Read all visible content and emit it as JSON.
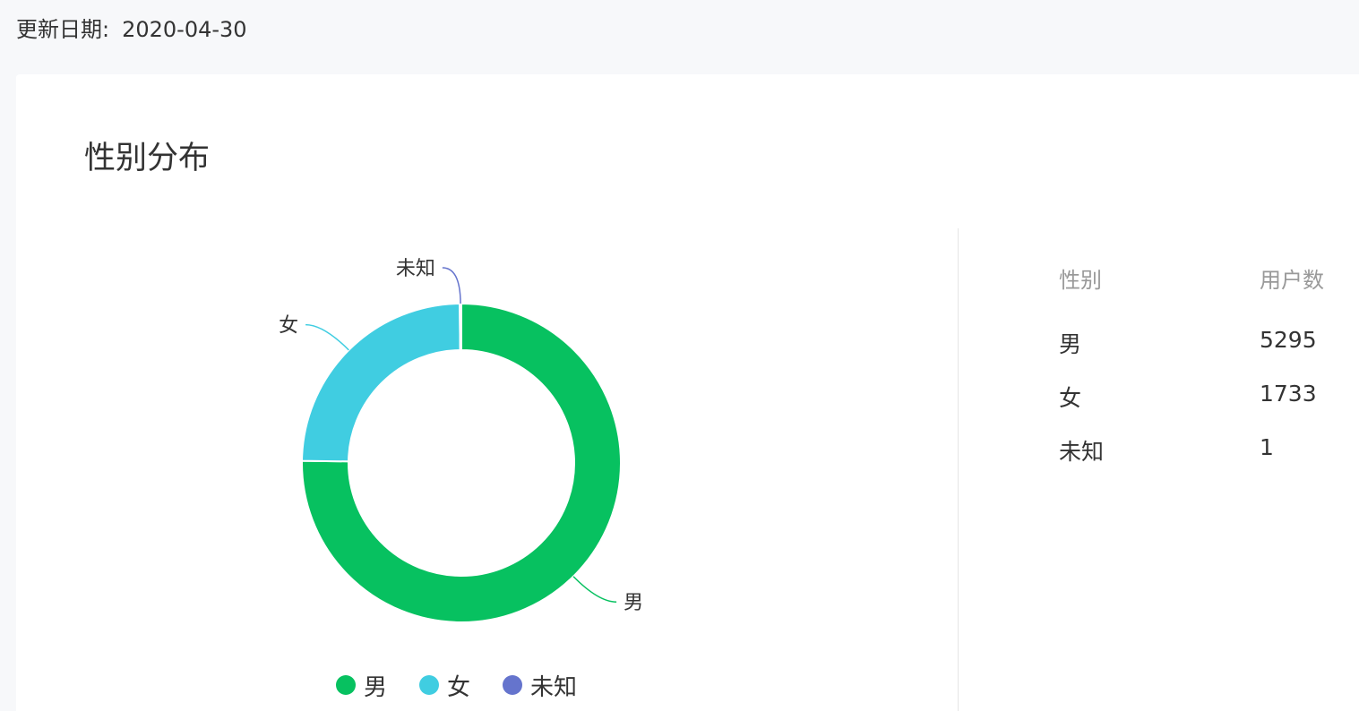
{
  "header": {
    "update_label": "更新日期:",
    "update_date": "2020-04-30"
  },
  "card": {
    "title": "性别分布"
  },
  "table": {
    "columns": [
      "性别",
      "用户数"
    ],
    "rows": [
      {
        "gender": "男",
        "count": "5295"
      },
      {
        "gender": "女",
        "count": "1733"
      },
      {
        "gender": "未知",
        "count": "1"
      }
    ]
  },
  "chart_data": {
    "type": "pie",
    "donut": true,
    "categories": [
      "男",
      "女",
      "未知"
    ],
    "values": [
      5295,
      1733,
      1
    ],
    "colors": [
      "#07c160",
      "#40cde1",
      "#6574cd"
    ],
    "legend": [
      "男",
      "女",
      "未知"
    ],
    "legend_position": "bottom"
  }
}
